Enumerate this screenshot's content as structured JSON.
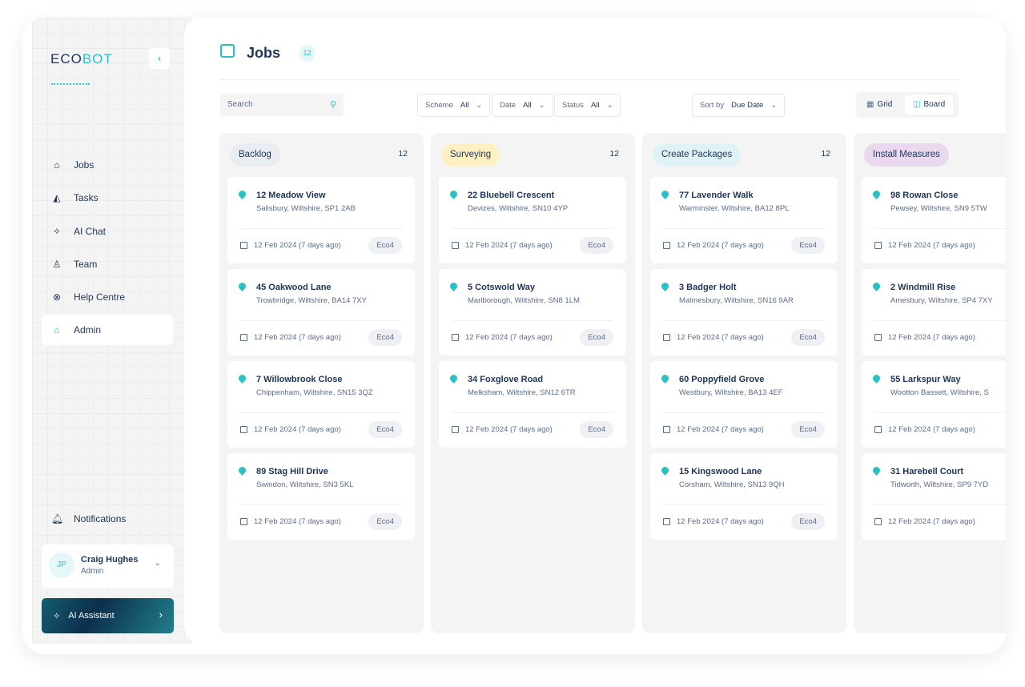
{
  "app": {
    "logo_a": "ECO",
    "logo_b": "BOT",
    "collapse_icon": "chevron-left-icon"
  },
  "sidebar": {
    "items": [
      {
        "label": "Jobs",
        "icon": "home-icon",
        "glyph": "⌂"
      },
      {
        "label": "Tasks",
        "icon": "tasks-icon",
        "glyph": "◭"
      },
      {
        "label": "AI Chat",
        "icon": "sparkle-icon",
        "glyph": "✧"
      },
      {
        "label": "Team",
        "icon": "user-icon",
        "glyph": "♙"
      },
      {
        "label": "Help Centre",
        "icon": "lifebuoy-icon",
        "glyph": "⊗"
      },
      {
        "label": "Admin",
        "icon": "home-icon",
        "glyph": "⌂",
        "active": true
      }
    ],
    "notifications": "Notifications",
    "user": {
      "initials": "JP",
      "name": "Craig Hughes",
      "role": "Admin"
    },
    "ai_assistant": "AI Assistant"
  },
  "header": {
    "title": "Jobs",
    "count": "12"
  },
  "toolbar": {
    "search_placeholder": "Search",
    "filters": [
      {
        "label": "Scheme",
        "value": "All"
      },
      {
        "label": "Date",
        "value": "All"
      },
      {
        "label": "Status",
        "value": "All"
      }
    ],
    "sort": {
      "label": "Sort by",
      "value": "Due Date"
    },
    "views": [
      {
        "label": "Grid",
        "active": false
      },
      {
        "label": "Board",
        "active": true
      }
    ]
  },
  "colors": {
    "accent": "#2bbfc6",
    "text": "#1d3557"
  },
  "columns": [
    {
      "title": "Backlog",
      "count": "12",
      "color": "#e8edf2",
      "cards": [
        {
          "address": "12 Meadow View",
          "town": "Salisbury, Wiltshire, SP1 2AB",
          "date": "12 Feb 2024 (7 days ago)",
          "scheme": "Eco4"
        },
        {
          "address": "45 Oakwood Lane",
          "town": "Trowbridge, Wiltshire, BA14 7XY",
          "date": "12 Feb 2024 (7 days ago)",
          "scheme": "Eco4"
        },
        {
          "address": "7 Willowbrook Close",
          "town": "Chippenham, Wiltshire, SN15 3QZ",
          "date": "12 Feb 2024 (7 days ago)",
          "scheme": "Eco4"
        },
        {
          "address": "89 Stag Hill Drive",
          "town": "Swindon, Wiltshire, SN3 5KL",
          "date": "12 Feb 2024 (7 days ago)",
          "scheme": "Eco4"
        }
      ]
    },
    {
      "title": "Surveying",
      "count": "12",
      "color": "#fdf1c4",
      "cards": [
        {
          "address": "22 Bluebell Crescent",
          "town": "Devizes, Wiltshire, SN10 4YP",
          "date": "12 Feb 2024 (7 days ago)",
          "scheme": "Eco4"
        },
        {
          "address": "5 Cotswold Way",
          "town": "Marlborough, Wiltshire, SN8 1LM",
          "date": "12 Feb 2024 (7 days ago)",
          "scheme": "Eco4"
        },
        {
          "address": "34 Foxglove Road",
          "town": "Melksham, Wiltshire, SN12 6TR",
          "date": "12 Feb 2024 (7 days ago)",
          "scheme": "Eco4"
        }
      ]
    },
    {
      "title": "Create Packages",
      "count": "12",
      "color": "#dff3f6",
      "cards": [
        {
          "address": "77 Lavender Walk",
          "town": "Warminster, Wiltshire, BA12 8PL",
          "date": "12 Feb 2024 (7 days ago)",
          "scheme": "Eco4"
        },
        {
          "address": "3 Badger Holt",
          "town": "Malmesbury, Wiltshire, SN16 9AR",
          "date": "12 Feb 2024 (7 days ago)",
          "scheme": "Eco4"
        },
        {
          "address": "60 Poppyfield Grove",
          "town": "Westbury, Wiltshire, BA13 4EF",
          "date": "12 Feb 2024 (7 days ago)",
          "scheme": "Eco4"
        },
        {
          "address": "15 Kingswood Lane",
          "town": "Corsham, Wiltshire, SN13 9QH",
          "date": "12 Feb 2024 (7 days ago)",
          "scheme": "Eco4"
        }
      ]
    },
    {
      "title": "Install Measures",
      "count": "",
      "color": "#ead8ef",
      "cards": [
        {
          "address": "98 Rowan Close",
          "town": "Pewsey, Wiltshire, SN9 5TW",
          "date": "12 Feb 2024 (7 days ago)",
          "scheme": ""
        },
        {
          "address": "2 Windmill Rise",
          "town": "Amesbury, Wiltshire, SP4 7XY",
          "date": "12 Feb 2024 (7 days ago)",
          "scheme": ""
        },
        {
          "address": "55 Larkspur Way",
          "town": "Wootton Bassett, Wiltshire, S",
          "date": "12 Feb 2024 (7 days ago)",
          "scheme": ""
        },
        {
          "address": "31 Harebell Court",
          "town": "Tidworth, Wiltshire, SP9 7YD",
          "date": "12 Feb 2024 (7 days ago)",
          "scheme": ""
        }
      ]
    }
  ]
}
